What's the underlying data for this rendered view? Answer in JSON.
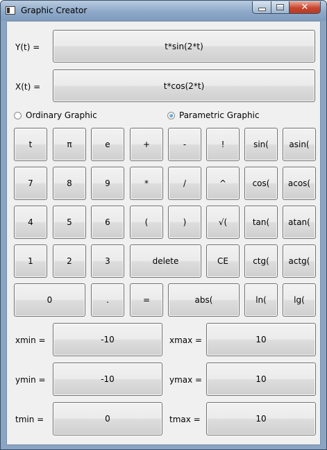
{
  "window": {
    "title": "Graphic Creator"
  },
  "titlebar": {
    "close_glyph": "✕"
  },
  "functions": {
    "y_label": "Y(t) =",
    "y_value": "t*sin(2*t)",
    "x_label": "X(t) =",
    "x_value": "t*cos(2*t)"
  },
  "mode": {
    "ordinary_label": "Ordinary Graphic",
    "parametric_label": "Parametric Graphic",
    "selected": "parametric"
  },
  "keypad": {
    "row1": [
      "t",
      "π",
      "e",
      "+",
      "-",
      "!",
      "sin(",
      "asin("
    ],
    "row2": [
      "7",
      "8",
      "9",
      "*",
      "/",
      "^",
      "cos(",
      "acos("
    ],
    "row3": [
      "4",
      "5",
      "6",
      "(",
      ")",
      "√(",
      "tan(",
      "atan("
    ],
    "row4": [
      "1",
      "2",
      "3",
      "delete",
      "CE",
      "ctg(",
      "actg("
    ],
    "row5": [
      "0",
      ".",
      "=",
      "abs(",
      "ln(",
      "lg("
    ]
  },
  "ranges": {
    "xmin_label": "xmin =",
    "xmin_value": "-10",
    "xmax_label": "xmax =",
    "xmax_value": "10",
    "ymin_label": "ymin =",
    "ymin_value": "-10",
    "ymax_label": "ymax =",
    "ymax_value": "10",
    "tmin_label": "tmin =",
    "tmin_value": "0",
    "tmax_label": "tmax =",
    "tmax_value": "10"
  }
}
